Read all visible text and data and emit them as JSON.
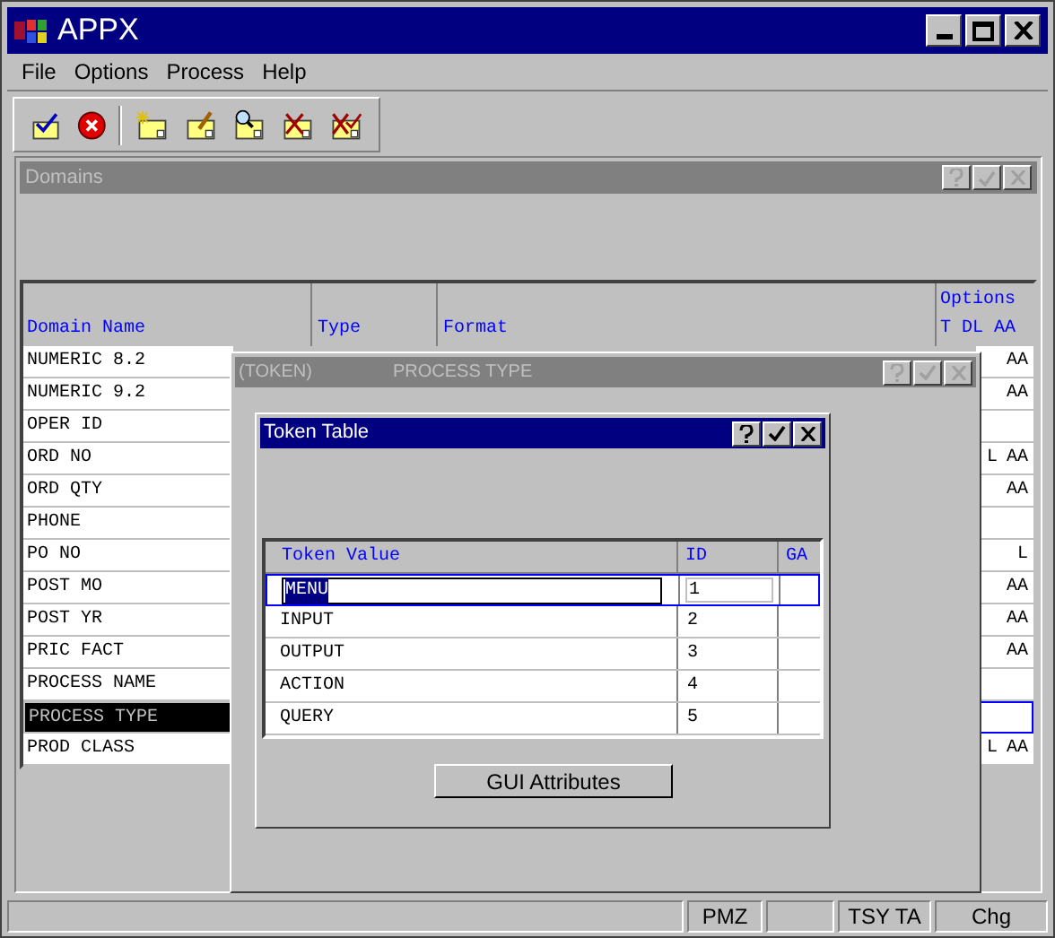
{
  "window": {
    "title": "APPX"
  },
  "menu": [
    "File",
    "Options",
    "Process",
    "Help"
  ],
  "domains_window": {
    "title": "Domains",
    "columns": {
      "name": "Domain Name",
      "type": "Type",
      "format": "Format",
      "options": "Options",
      "options_sub": "T DL AA"
    },
    "rows": [
      {
        "name": "NUMERIC 8.2",
        "aa": "AA",
        "selected": false
      },
      {
        "name": "NUMERIC 9.2",
        "aa": "AA",
        "selected": false
      },
      {
        "name": "OPER ID",
        "selected": false
      },
      {
        "name": "ORD NO",
        "dl": "L",
        "aa": "AA",
        "selected": false
      },
      {
        "name": "ORD QTY",
        "aa": "AA",
        "selected": false
      },
      {
        "name": "PHONE",
        "selected": false
      },
      {
        "name": "PO NO",
        "dl": "L",
        "selected": false
      },
      {
        "name": "POST MO",
        "aa": "AA",
        "selected": false
      },
      {
        "name": "POST YR",
        "aa": "AA",
        "selected": false
      },
      {
        "name": "PRIC FACT",
        "aa": "AA",
        "selected": false
      },
      {
        "name": "PROCESS NAME",
        "selected": false
      },
      {
        "name": "PROCESS TYPE",
        "selected": true
      },
      {
        "name": "PROD CLASS",
        "dl": "L",
        "aa": "AA",
        "selected": false
      }
    ]
  },
  "process_window": {
    "title_left": "(TOKEN)",
    "title_right": "PROCESS TYPE"
  },
  "token_window": {
    "title": "Token Table",
    "columns": [
      "Token Value",
      "ID",
      "GA"
    ],
    "rows": [
      {
        "value": "MENU",
        "id": "1",
        "selected": true
      },
      {
        "value": "INPUT",
        "id": "2",
        "selected": false
      },
      {
        "value": "OUTPUT",
        "id": "3",
        "selected": false
      },
      {
        "value": "ACTION",
        "id": "4",
        "selected": false
      },
      {
        "value": "QUERY",
        "id": "5",
        "selected": false
      }
    ],
    "button": "GUI Attributes"
  },
  "status_bar": [
    "PMZ",
    "TSY TA",
    "Chg"
  ]
}
